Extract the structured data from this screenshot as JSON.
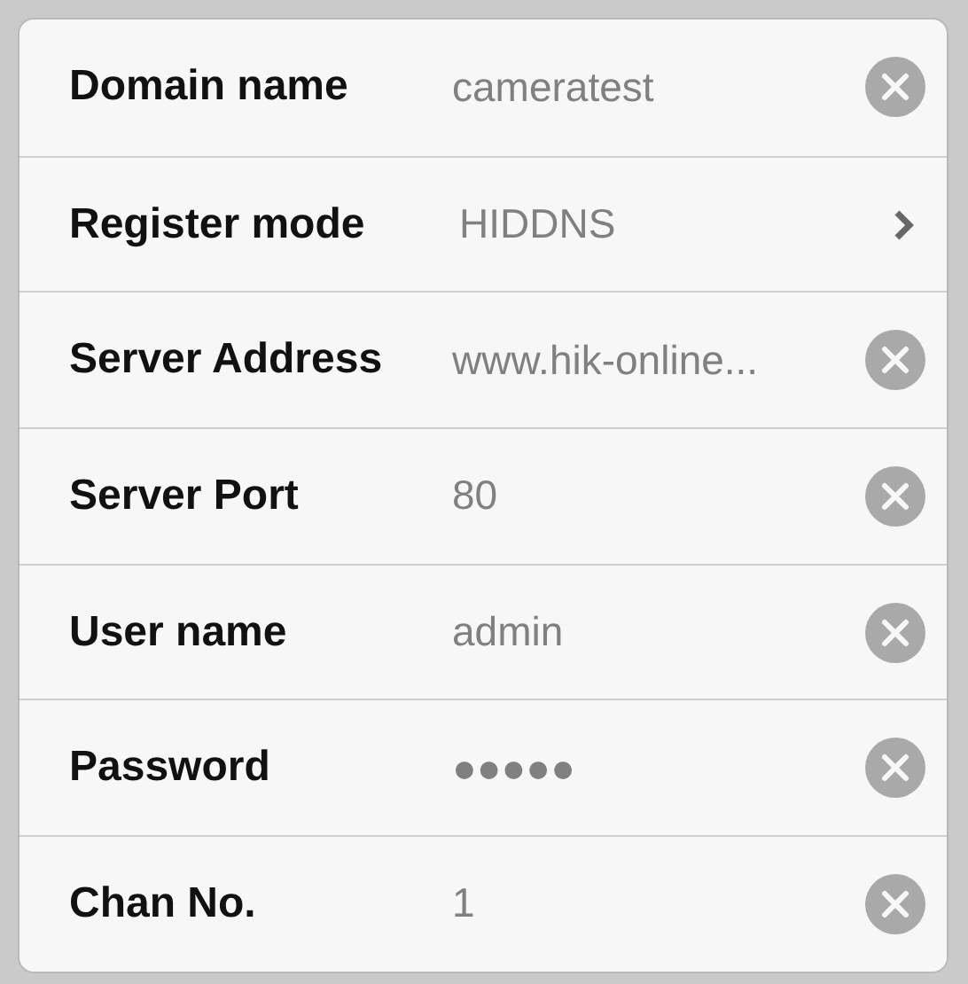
{
  "rows": [
    {
      "label": "Domain name",
      "value": "cameratest",
      "kind": "field"
    },
    {
      "label": "Register mode",
      "value": "HIDDNS",
      "kind": "picker"
    },
    {
      "label": "Server Address",
      "value": "www.hik-online...",
      "kind": "field"
    },
    {
      "label": "Server Port",
      "value": "80",
      "kind": "field"
    },
    {
      "label": "User name",
      "value": "admin",
      "kind": "field"
    },
    {
      "label": "Password",
      "value": "●●●●●",
      "kind": "field"
    },
    {
      "label": "Chan No.",
      "value": "1",
      "kind": "field"
    }
  ]
}
